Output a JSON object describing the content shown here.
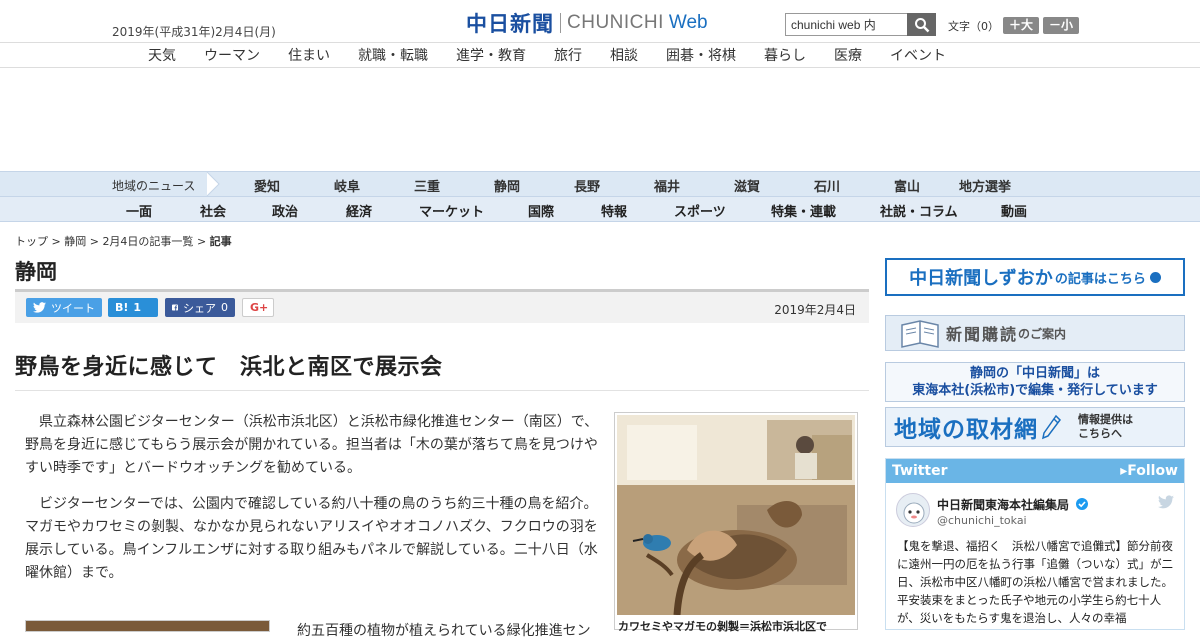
{
  "header": {
    "date": "2019年(平成31年)2月4日(月)",
    "logo_jp": "中日新聞",
    "logo_en": "CHUNICHI",
    "logo_web": "Web",
    "search_value": "chunichi web 内",
    "font_label": "文字（0）",
    "font_larger": "＋大",
    "font_smaller": "－小"
  },
  "global_nav": [
    "天気",
    "ウーマン",
    "住まい",
    "就職・転職",
    "進学・教育",
    "旅行",
    "相談",
    "囲碁・将棋",
    "暮らし",
    "医療",
    "イベント"
  ],
  "region_nav": {
    "label": "地域のニュース",
    "items": [
      "愛知",
      "岐阜",
      "三重",
      "静岡",
      "長野",
      "福井",
      "滋賀",
      "石川",
      "富山",
      "地方選挙"
    ]
  },
  "category_nav": [
    "一面",
    "社会",
    "政治",
    "経済",
    "マーケット",
    "国際",
    "特報",
    "スポーツ",
    "特集・連載",
    "社説・コラム",
    "動画"
  ],
  "breadcrumb": {
    "items": [
      "トップ",
      "静岡",
      "2月4日の記事一覧"
    ],
    "current": "記事",
    "separator": ">"
  },
  "section_title": "静岡",
  "share": {
    "tweet": "ツイート",
    "hatena": "B!",
    "hatena_count": "1",
    "facebook": "シェア",
    "facebook_count": "0",
    "gplus": "G+",
    "date": "2019年2月4日"
  },
  "article": {
    "headline": "野鳥を身近に感じて　浜北と南区で展示会",
    "paragraphs": [
      "県立森林公園ビジターセンター（浜松市浜北区）と浜松市緑化推進センター（南区）で、野鳥を身近に感じてもらう展示会が開かれている。担当者は「木の葉が落ちて鳥を見つけやすい時季です」とバードウオッチングを勧めている。",
      "ビジターセンターでは、公園内で確認している約八十種の鳥のうち約三十種の鳥を紹介。マガモやカワセミの剝製、なかなか見られないアリスイやオオコノハズク、フクロウの羽を展示している。鳥インフルエンザに対する取り組みもパネルで解説している。二十八日（水曜休館）まで。"
    ],
    "photo_caption": "カワセミやマガモの剝製＝浜松市浜北区で",
    "next_text": "約五百種の植物が植えられている緑化推進セン"
  },
  "sidebar": {
    "banner1_title": "中日新聞しずおか",
    "banner1_sub": "の記事はこちら",
    "banner2_title": "新聞購読",
    "banner2_sub": "のご案内",
    "banner3_line1": "静岡の「中日新聞」は",
    "banner3_line2": "東海本社(浜松市)で編集・発行しています",
    "banner4_title": "地域の取材網",
    "banner4_sub1": "情報提供は",
    "banner4_sub2": "こちらへ"
  },
  "twitter": {
    "header": "Twitter",
    "follow": "▸Follow",
    "name": "中日新聞東海本社編集局",
    "handle": "@chunichi_tokai",
    "text": "【鬼を撃退、福招く　浜松八幡宮で追儺式】節分前夜に遠州一円の厄を払う行事「追儺（ついな）式」が二日、浜松市中区八幡町の浜松八幡宮で営まれました。平安装束をまとった氏子や地元の小学生ら約七十人が、災いをもたらす鬼を退治し、人々の幸福"
  },
  "colors": {
    "brand_blue": "#1a4fa0",
    "link_blue": "#1a6fc0",
    "twitter_blue": "#6ab5e6",
    "nav_bg": "#dce8f4"
  }
}
